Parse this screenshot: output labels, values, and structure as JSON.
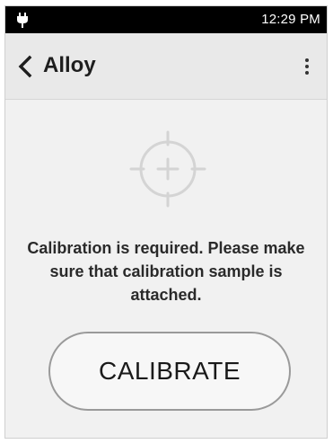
{
  "status_bar": {
    "time": "12:29 PM",
    "left_icon": "plug-icon"
  },
  "app_bar": {
    "back_icon": "chevron-left-icon",
    "title": "Alloy",
    "menu_icon": "more-vert-icon"
  },
  "main": {
    "illustration_icon": "crosshair-target-icon",
    "message": "Calibration is required. Please make sure that calibration sample is attached.",
    "calibrate_button_label": "CALIBRATE"
  }
}
